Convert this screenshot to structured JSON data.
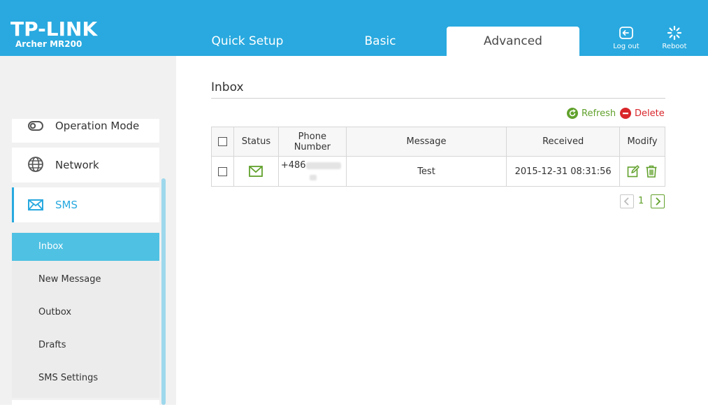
{
  "brand": {
    "logo": "TP-LINK",
    "model": "Archer MR200"
  },
  "tabs": [
    {
      "label": "Quick Setup"
    },
    {
      "label": "Basic"
    },
    {
      "label": "Advanced",
      "active": true
    }
  ],
  "header_buttons": {
    "logout": "Log out",
    "reboot": "Reboot"
  },
  "sidebar": {
    "items": [
      {
        "label": "Operation Mode",
        "icon": "operation-mode-icon"
      },
      {
        "label": "Network",
        "icon": "globe-icon"
      },
      {
        "label": "SMS",
        "icon": "envelope-icon",
        "expanded": true
      }
    ],
    "sms_subitems": [
      {
        "label": "Inbox",
        "active": true
      },
      {
        "label": "New Message"
      },
      {
        "label": "Outbox"
      },
      {
        "label": "Drafts"
      },
      {
        "label": "SMS Settings"
      }
    ]
  },
  "main": {
    "title": "Inbox",
    "actions": {
      "refresh": "Refresh",
      "delete": "Delete"
    },
    "table": {
      "columns": [
        "Status",
        "Phone Number",
        "Message",
        "Received",
        "Modify"
      ],
      "rows": [
        {
          "status_icon": "envelope-icon",
          "phone_prefix": "+486",
          "message": "Test",
          "received": "2015-12-31 08:31:56"
        }
      ]
    },
    "pagination": {
      "current_page": "1"
    }
  },
  "colors": {
    "header": "#29a9df",
    "accent_green": "#61a12c",
    "delete_red": "#d9262a",
    "active_sub": "#4fc1e3"
  }
}
